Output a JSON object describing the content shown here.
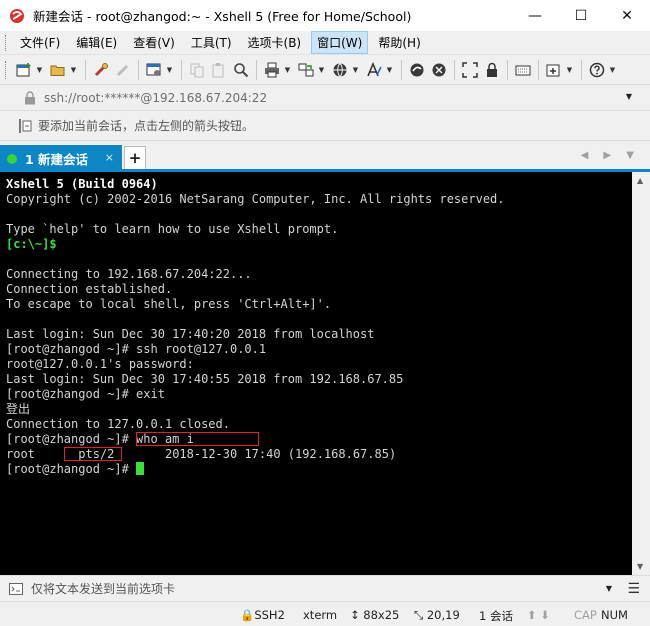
{
  "window": {
    "title": "新建会话 - root@zhangod:~ - Xshell 5 (Free for Home/School)",
    "minimize": "—",
    "maximize": "☐",
    "close": "✕"
  },
  "menu": {
    "items": [
      {
        "label": "文件(F)"
      },
      {
        "label": "编辑(E)"
      },
      {
        "label": "查看(V)"
      },
      {
        "label": "工具(T)"
      },
      {
        "label": "选项卡(B)"
      },
      {
        "label": "窗口(W)"
      },
      {
        "label": "帮助(H)"
      }
    ]
  },
  "address": {
    "value": "ssh://root:******@192.168.67.204:22"
  },
  "hint": {
    "text": "要添加当前会话，点击左侧的箭头按钮。"
  },
  "tabs": {
    "active_label": "1 新建会话",
    "close_glyph": "×",
    "add_glyph": "+",
    "nav": "◀ ▶ ▼"
  },
  "terminal": {
    "lines": [
      "Xshell 5 (Build 0964)",
      "Copyright (c) 2002-2016 NetSarang Computer, Inc. All rights reserved.",
      "",
      "Type `help' to learn how to use Xshell prompt.",
      "[c:\\~]$",
      "",
      "Connecting to 192.168.67.204:22...",
      "Connection established.",
      "To escape to local shell, press 'Ctrl+Alt+]'.",
      "",
      "Last login: Sun Dec 30 17:40:20 2018 from localhost",
      "[root@zhangod ~]# ssh root@127.0.0.1",
      "root@127.0.0.1's password:",
      "Last login: Sun Dec 30 17:40:55 2018 from 192.168.67.85",
      "[root@zhangod ~]# exit",
      "登出",
      "Connection to 127.0.0.1 closed."
    ],
    "who_prompt": "[root@zhangod ~]# ",
    "who_cmd": "who am i",
    "who_user": "root",
    "who_tty": "pts/2",
    "who_rest": "2018-12-30 17:40 (192.168.67.85)",
    "final_prompt": "[root@zhangod ~]# "
  },
  "send": {
    "placeholder": "仅将文本发送到当前选项卡"
  },
  "status": {
    "protocol": "SSH2",
    "term": "xterm",
    "size": "88x25",
    "position": "20,19",
    "sessions": "1 会话",
    "caps": "CAP",
    "num": "NUM"
  },
  "colors": {
    "accent": "#0e86c6",
    "terminal_bg": "#000000",
    "prompt_green": "#3bde3b",
    "highlight_red": "#e22222"
  }
}
